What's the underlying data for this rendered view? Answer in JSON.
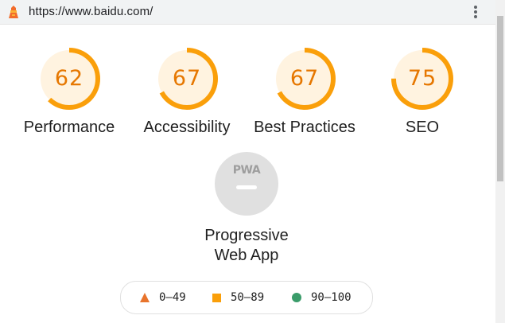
{
  "address_bar": {
    "url": "https://www.baidu.com/",
    "menu_icon": "kebab-menu-icon",
    "logo_icon": "lighthouse-icon"
  },
  "scores": [
    {
      "value": "62",
      "label": "Performance",
      "fraction": 0.62
    },
    {
      "value": "67",
      "label": "Accessibility",
      "fraction": 0.67
    },
    {
      "value": "67",
      "label": "Best Practices",
      "fraction": 0.67
    },
    {
      "value": "75",
      "label": "SEO",
      "fraction": 0.75
    }
  ],
  "pwa": {
    "badge": "PWA",
    "label_line1": "Progressive",
    "label_line2": "Web App"
  },
  "legend": {
    "fail": "0–49",
    "average": "50–89",
    "pass": "90–100"
  },
  "colors": {
    "average": "#fa9f0a",
    "average_text": "#e67700",
    "average_bg": "#fff3e0",
    "fail": "#e8742c",
    "pass": "#3a9c6a"
  }
}
